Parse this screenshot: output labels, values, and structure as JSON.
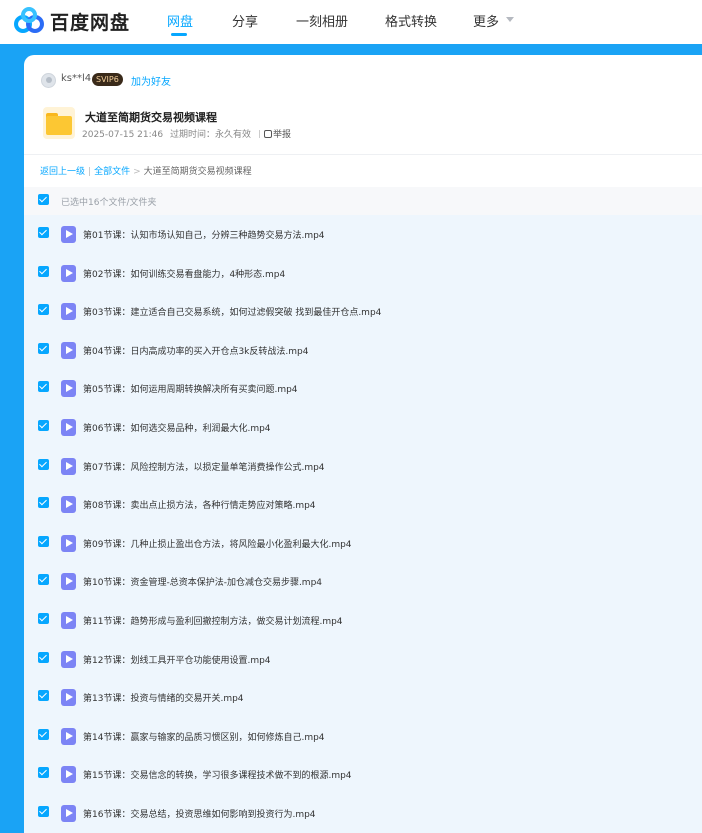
{
  "brand": {
    "name": "百度网盘",
    "colors": {
      "accent": "#06a7ff",
      "background": "#1aa3f5"
    }
  },
  "nav": {
    "items": [
      {
        "label": "网盘",
        "active": true
      },
      {
        "label": "分享",
        "active": false
      },
      {
        "label": "一刻相册",
        "active": false
      },
      {
        "label": "格式转换",
        "active": false
      },
      {
        "label": "更多",
        "active": false
      }
    ]
  },
  "share": {
    "owner_name": "ks**l4",
    "vip_badge": "SVIP6",
    "add_friend": "加为好友",
    "title": "大道至简期货交易视频课程",
    "date": "2025-07-15 21:46",
    "expiry": "过期时间：永久有效",
    "report": "举报"
  },
  "breadcrumb": {
    "back": "返回上一级",
    "all_files": "全部文件",
    "current": "大道至简期货交易视频课程"
  },
  "list": {
    "selected_text": "已选中16个文件/文件夹",
    "files": [
      {
        "name": "第01节课：认知市场认知自己，分辨三种趋势交易方法.mp4"
      },
      {
        "name": "第02节课：如何训练交易看盘能力，4种形态.mp4"
      },
      {
        "name": "第03节课：建立适合自己交易系统，如何过滤假突破 找到最佳开仓点.mp4"
      },
      {
        "name": "第04节课：日内高成功率的买入开仓点3k反转战法.mp4"
      },
      {
        "name": "第05节课：如何运用周期转换解决所有买卖问题.mp4"
      },
      {
        "name": "第06节课：如何选交易品种，利润最大化.mp4"
      },
      {
        "name": "第07节课：风险控制方法，以损定量单笔消费操作公式.mp4"
      },
      {
        "name": "第08节课：卖出点止损方法，各种行情走势应对策略.mp4"
      },
      {
        "name": "第09节课：几种止损止盈出仓方法，将风险最小化盈利最大化.mp4"
      },
      {
        "name": "第10节课：资金管理-总资本保护法-加仓减仓交易步骤.mp4"
      },
      {
        "name": "第11节课：趋势形成与盈利回撤控制方法，做交易计划流程.mp4"
      },
      {
        "name": "第12节课：划线工具开平仓功能使用设置.mp4"
      },
      {
        "name": "第13节课：投资与情绪的交易开关.mp4"
      },
      {
        "name": "第14节课：赢家与输家的品质习惯区别，如何修炼自己.mp4"
      },
      {
        "name": "第15节课：交易信念的转换，学习很多课程技术做不到的根源.mp4"
      },
      {
        "name": "第16节课：交易总结，投资思维如何影响到投资行为.mp4"
      }
    ]
  }
}
